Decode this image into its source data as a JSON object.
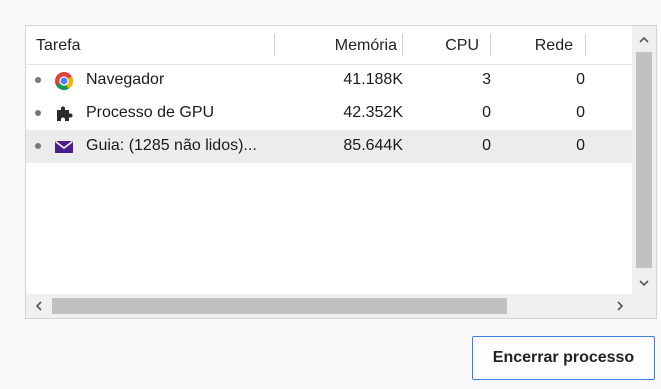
{
  "header": {
    "task": "Tarefa",
    "memory": "Memória",
    "cpu": "CPU",
    "network": "Rede"
  },
  "rows": [
    {
      "icon": "chrome-icon",
      "name": "Navegador",
      "memory": "41.188K",
      "cpu": "3",
      "network": "0"
    },
    {
      "icon": "puzzle-piece-icon",
      "name": "Processo de GPU",
      "memory": "42.352K",
      "cpu": "0",
      "network": "0"
    },
    {
      "icon": "mail-envelope-icon",
      "name": "Guia: (1285 não lidos)...",
      "memory": "85.644K",
      "cpu": "0",
      "network": "0"
    }
  ],
  "selected_row": 2,
  "end_process_button": "Encerrar processo",
  "colors": {
    "button_border": "#3c7fe0",
    "selected_row": "#ececec",
    "mail_icon": "#4a1d8c"
  }
}
